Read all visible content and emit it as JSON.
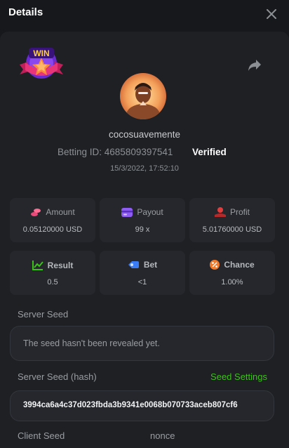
{
  "header": {
    "title": "Details"
  },
  "player": {
    "username": "cocosuavemente",
    "betting_id": "Betting ID: 4685809397541",
    "verified": "Verified",
    "timestamp": "15/3/2022, 17:52:10"
  },
  "badge": {
    "text": "WIN"
  },
  "stats": [
    {
      "label": "Amount",
      "value": "0.05120000 USD",
      "icon": "coins-icon",
      "color": "#e94a7a"
    },
    {
      "label": "Payout",
      "value": "99 x",
      "icon": "card-icon",
      "color": "#8e5cf3"
    },
    {
      "label": "Profit",
      "value": "5.01760000 USD",
      "icon": "profit-icon",
      "color": "#e23d3d"
    },
    {
      "label": "Result",
      "value": "0.5",
      "icon": "chart-icon",
      "color": "#3bc117"
    },
    {
      "label": "Bet",
      "value": "<1",
      "icon": "bet-icon",
      "color": "#3a7cf5"
    },
    {
      "label": "Chance",
      "value": "1.00%",
      "icon": "percent-icon",
      "color": "#f07a2a"
    }
  ],
  "server_seed": {
    "label": "Server Seed",
    "value": "The seed hasn't been revealed yet."
  },
  "server_seed_hash": {
    "label": "Server Seed (hash)",
    "link": "Seed Settings",
    "value": "3994ca6a4c37d023fbda3b9341e0068b070733aceb807cf6"
  },
  "client_seed": {
    "label": "Client Seed"
  },
  "nonce": {
    "label": "nonce"
  },
  "colors": {
    "background": "#17181b",
    "panel": "#1e2024",
    "card": "#25272c",
    "accent_green": "#3bc117"
  }
}
